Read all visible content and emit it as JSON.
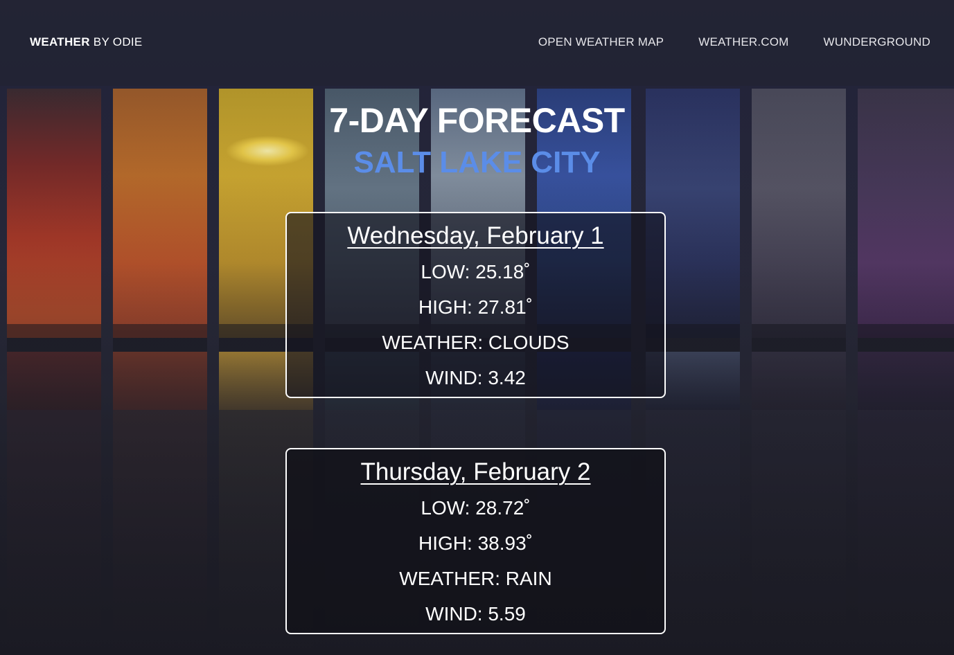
{
  "brand": {
    "bold": "WEATHER",
    "rest": " BY ODIE"
  },
  "nav": {
    "links": [
      "OPEN WEATHER MAP",
      "WEATHER.COM",
      "WUNDERGROUND"
    ]
  },
  "main": {
    "title": "7-DAY FORECAST",
    "city": "SALT LAKE CITY"
  },
  "forecast": [
    {
      "date": "Wednesday, February 1",
      "low": "LOW: 25.18˚",
      "high": "HIGH: 27.81˚",
      "weather": "WEATHER: CLOUDS",
      "wind": "WIND: 3.42"
    },
    {
      "date": "Thursday, February 2",
      "low": "LOW: 28.72˚",
      "high": "HIGH: 38.93˚",
      "weather": "WEATHER: RAIN",
      "wind": "WIND: 5.59"
    }
  ],
  "colors": {
    "accent_city": "#5b8de8",
    "header_bg": "#232434",
    "card_border": "#ffffff"
  }
}
